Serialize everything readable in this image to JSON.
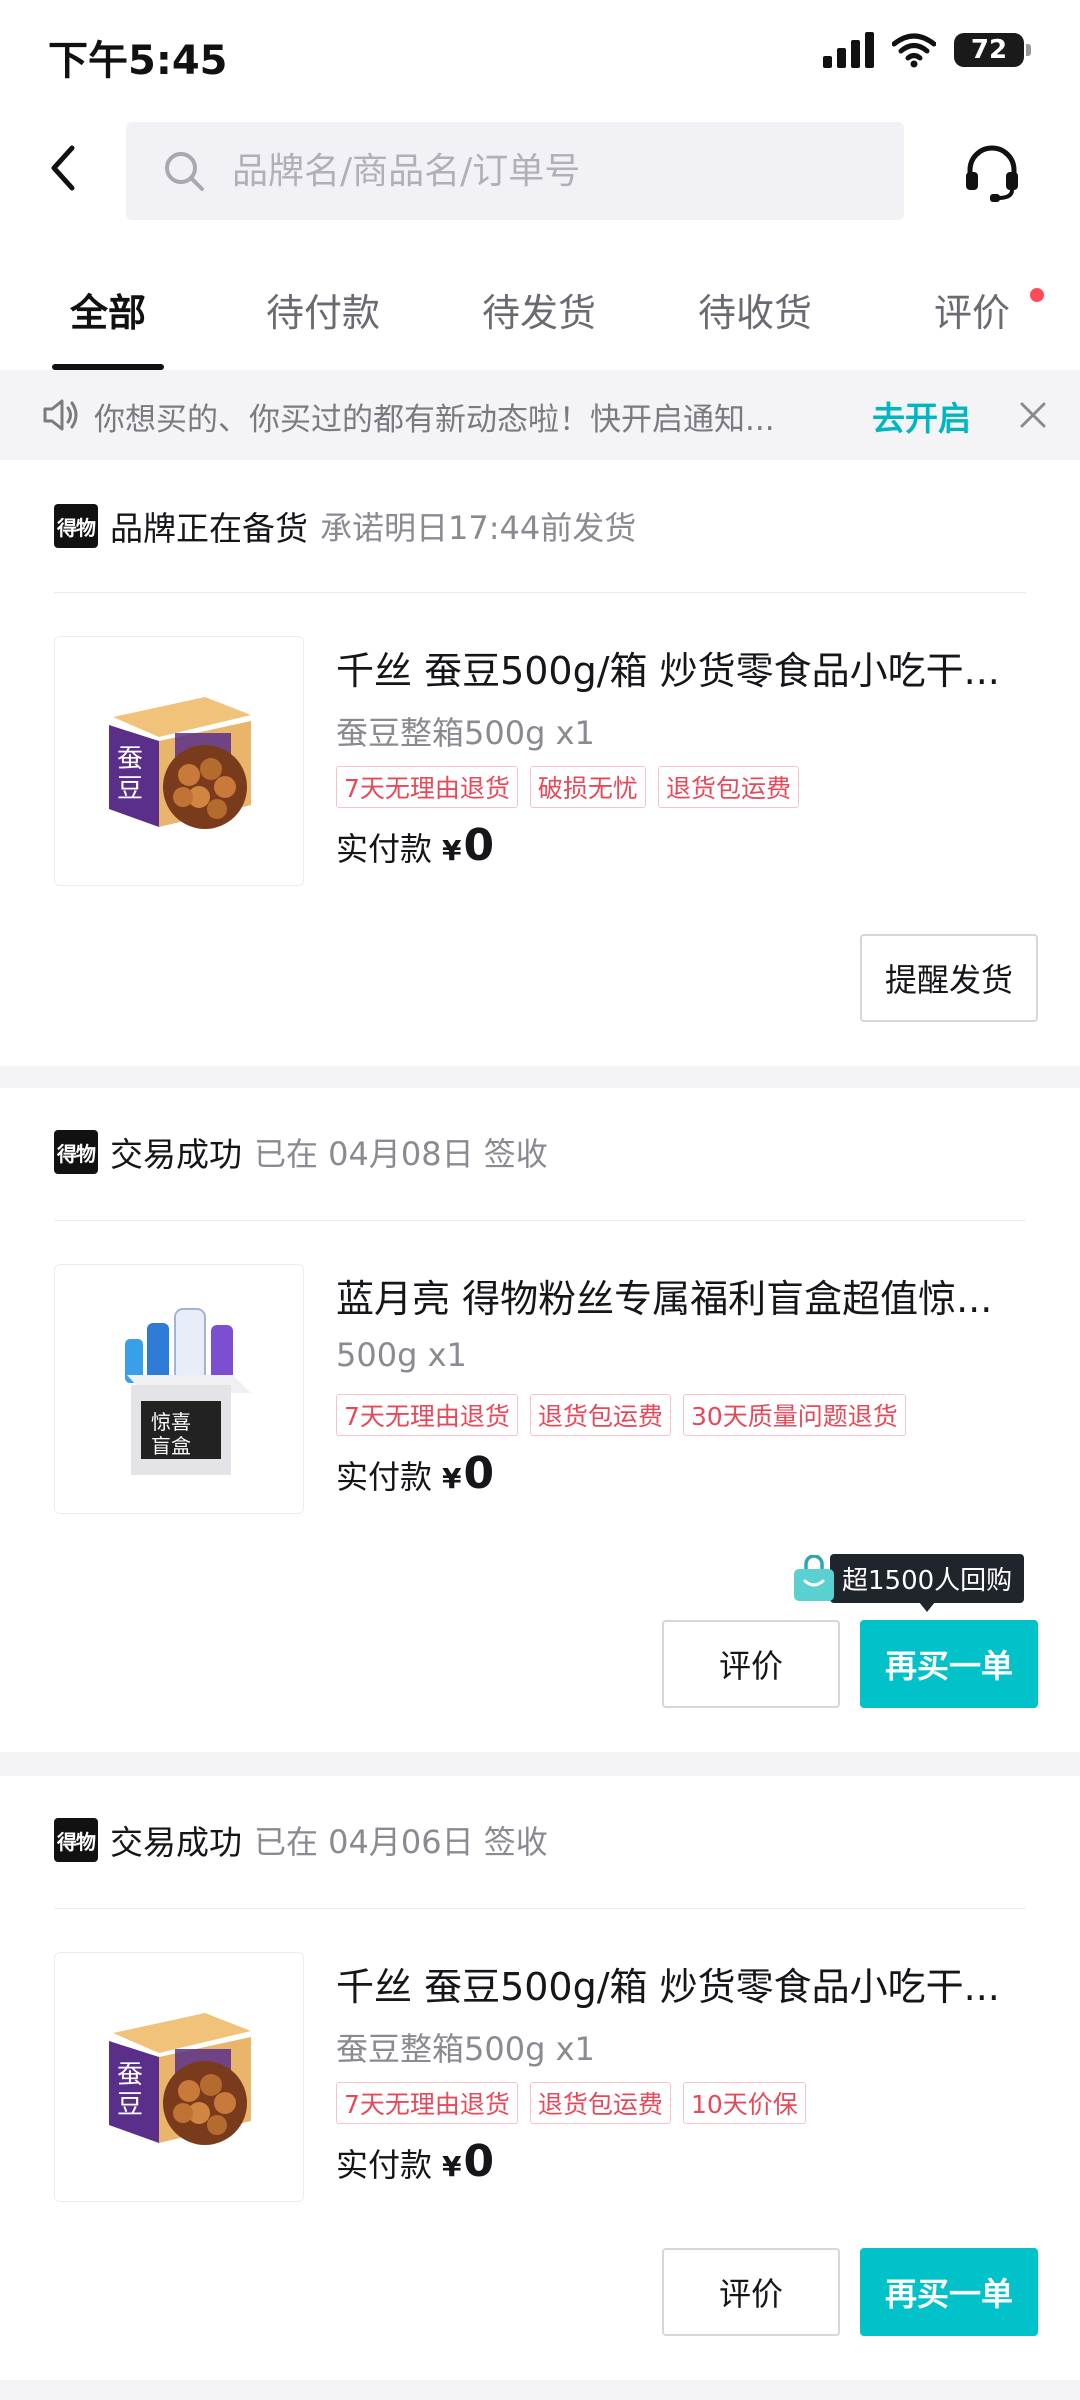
{
  "status_bar": {
    "time": "下午5:45",
    "battery": "72"
  },
  "header": {
    "search_placeholder": "品牌名/商品名/订单号"
  },
  "tabs": [
    {
      "label": "全部",
      "active": true
    },
    {
      "label": "待付款"
    },
    {
      "label": "待发货"
    },
    {
      "label": "待收货"
    },
    {
      "label": "评价",
      "has_dot": true
    }
  ],
  "notice": {
    "text": "你想买的、你买过的都有新动态啦！快开启通知...",
    "action": "去开启"
  },
  "orders": [
    {
      "logo": "得物",
      "status": "品牌正在备货",
      "info": "承诺明日17:44前发货",
      "title": "千丝 蚕豆500g/箱 炒货零食品小吃干...",
      "spec": "蚕豆整箱500g x1",
      "tags": [
        "7天无理由退货",
        "破损无忧",
        "退货包运费"
      ],
      "paid_label": "实付款",
      "currency": "¥",
      "amount": "0",
      "buttons": [
        "提醒发货"
      ]
    },
    {
      "logo": "得物",
      "status": "交易成功",
      "info": "已在 04月08日 签收",
      "title": "蓝月亮 得物粉丝专属福利盲盒超值惊...",
      "spec": "500g x1",
      "tags": [
        "7天无理由退货",
        "退货包运费",
        "30天质量问题退货"
      ],
      "paid_label": "实付款",
      "currency": "¥",
      "amount": "0",
      "rebuy_tip": "超1500人回购",
      "buttons": [
        "评价",
        "再买一单"
      ]
    },
    {
      "logo": "得物",
      "status": "交易成功",
      "info": "已在 04月06日 签收",
      "title": "千丝 蚕豆500g/箱 炒货零食品小吃干...",
      "spec": "蚕豆整箱500g x1",
      "tags": [
        "7天无理由退货",
        "退货包运费",
        "10天价保"
      ],
      "paid_label": "实付款",
      "currency": "¥",
      "amount": "0",
      "buttons": [
        "评价",
        "再买一单"
      ]
    }
  ],
  "colors": {
    "accent": "#00c2c8",
    "tag_red": "#e64a5a",
    "badge_dot": "#ff4a5a"
  },
  "icons": [
    "back-arrow-icon",
    "search-icon",
    "headset-icon",
    "speaker-icon",
    "close-icon",
    "wifi-icon",
    "signal-icon",
    "battery-icon",
    "shopping-bag-icon"
  ]
}
